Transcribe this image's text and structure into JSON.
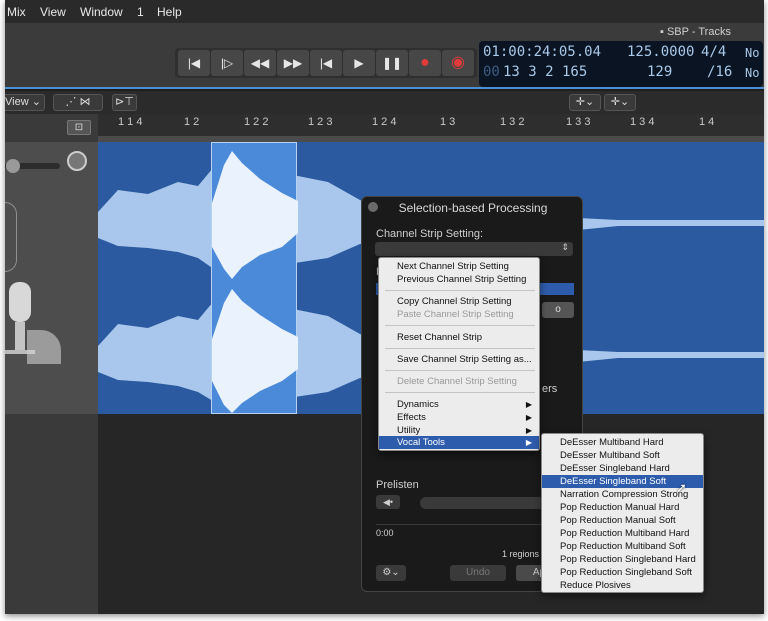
{
  "menu": {
    "mix": "Mix",
    "view": "View",
    "window": "Window",
    "one": "1",
    "help": "Help"
  },
  "window_title": "SBP - Tracks",
  "lcd": {
    "position": "01:00:24:05.04",
    "bars_small": "00",
    "bars": "13  3  2  165",
    "tempo": "125.0000",
    "tempo_sub": "129",
    "sig_top": "4/4",
    "sig_bottom": "/16",
    "no1": "No",
    "no2": "No"
  },
  "toolbar": {
    "view": "View"
  },
  "ruler": [
    "1 1 4",
    "1 2",
    "1 2 2",
    "1 2 3",
    "1 2 4",
    "1 3",
    "1 3 2",
    "1 3 3",
    "1 3 4",
    "1 4"
  ],
  "panel": {
    "title": "Selection-based Processing",
    "strip_label": "Channel Strip Setting:",
    "prelisten": "Prelisten",
    "time": "0:00",
    "regions": "1 regions",
    "undo": "Undo",
    "apply": "Ap"
  },
  "context_menu": [
    {
      "label": "Next Channel Strip Setting",
      "disabled": false
    },
    {
      "label": "Previous Channel Strip Setting",
      "disabled": false
    },
    {
      "label": "Copy Channel Strip Setting",
      "disabled": false
    },
    {
      "label": "Paste Channel Strip Setting",
      "disabled": true
    },
    {
      "label": "Reset Channel Strip",
      "disabled": false
    },
    {
      "label": "Save Channel Strip Setting as...",
      "disabled": false
    },
    {
      "label": "Delete Channel Strip Setting",
      "disabled": true
    },
    {
      "label": "Dynamics",
      "disabled": false
    },
    {
      "label": "Effects",
      "disabled": false
    },
    {
      "label": "Utility",
      "disabled": false
    },
    {
      "label": "Vocal Tools",
      "disabled": false
    }
  ],
  "submenu": [
    "DeEsser Multiband Hard",
    "DeEsser Multiband Soft",
    "DeEsser Singleband Hard",
    "DeEsser Singleband Soft",
    "Narration Compression Strong",
    "Pop Reduction Manual Hard",
    "Pop Reduction Manual Soft",
    "Pop Reduction Multiband Hard",
    "Pop Reduction Multiband Soft",
    "Pop Reduction Singleband Hard",
    "Pop Reduction Singleband Soft",
    "Reduce Plosives"
  ],
  "behind_text": "ers",
  "colors": {
    "accent": "#2e5cad",
    "record": "#e03a3a",
    "region": "#2b5aa0",
    "waveform": "#a9c7ec"
  }
}
